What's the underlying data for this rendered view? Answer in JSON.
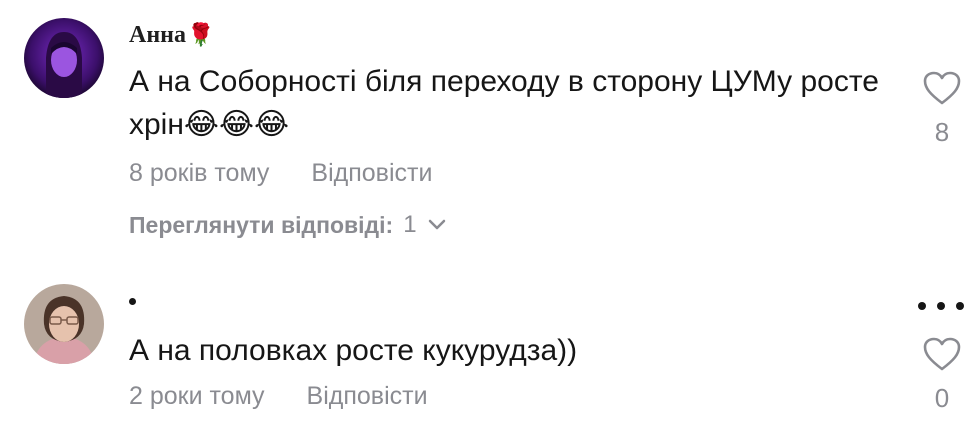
{
  "comments": [
    {
      "author": "Анна",
      "author_emoji": "🌹",
      "text": "А на Соборності біля переходу в сторону ЦУМу росте хрін😂😂😂",
      "time": "8 років тому",
      "reply_label": "Відповісти",
      "likes": "8",
      "view_replies_label": "Переглянути відповіді:",
      "replies_count": "1"
    },
    {
      "author": "•",
      "text": "А на половках росте кукурудза))",
      "time": "2 роки тому",
      "reply_label": "Відповісти",
      "likes": "0"
    }
  ],
  "icons": {
    "like": "heart-outline-icon",
    "expand": "chevron-down-icon",
    "menu": "more-horizontal-icon"
  },
  "colors": {
    "text": "#161616",
    "muted": "#8a8b91",
    "background": "#ffffff"
  }
}
